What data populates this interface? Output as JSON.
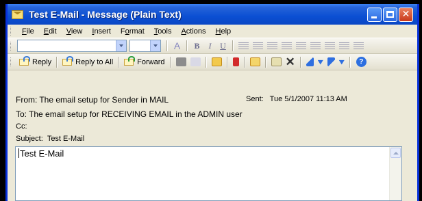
{
  "window": {
    "title": "Test E-Mail - Message (Plain Text)"
  },
  "menu": [
    {
      "label": "File",
      "accel": "F",
      "rest": "ile"
    },
    {
      "label": "Edit",
      "accel": "E",
      "rest": "dit"
    },
    {
      "label": "View",
      "accel": "V",
      "rest": "iew"
    },
    {
      "label": "Insert",
      "accel": "I",
      "rest": "nsert"
    },
    {
      "label": "Format",
      "pre": "F",
      "accel": "o",
      "rest": "rmat"
    },
    {
      "label": "Tools",
      "accel": "T",
      "rest": "ools"
    },
    {
      "label": "Actions",
      "accel": "A",
      "rest": "ctions"
    },
    {
      "label": "Help",
      "accel": "H",
      "rest": "elp"
    }
  ],
  "format_toolbar": {
    "font_value": "",
    "size_value": "",
    "font_color_glyph": "A",
    "bold_glyph": "B",
    "italic_glyph": "I",
    "underline_glyph": "U"
  },
  "actions": {
    "reply": "Reply",
    "reply_all": "Reply to All",
    "forward": "Forward",
    "delete_glyph": "✕",
    "help_glyph": "?"
  },
  "message": {
    "from_label": "From:",
    "from_value": "The email setup for Sender in MAIL",
    "sent_label": "Sent:",
    "sent_value": "Tue 5/1/2007 11:13 AM",
    "to_label": "To:",
    "to_value": "The email setup for RECEIVING EMAIL in the ADMIN user",
    "cc_label": "Cc:",
    "cc_value": "",
    "subject_label": "Subject:",
    "subject_value": "Test E-Mail",
    "body": "Test E-Mail"
  },
  "colors": {
    "titlebar": "#0b4fd3",
    "chrome": "#ece9d8",
    "close": "#c8381b"
  }
}
